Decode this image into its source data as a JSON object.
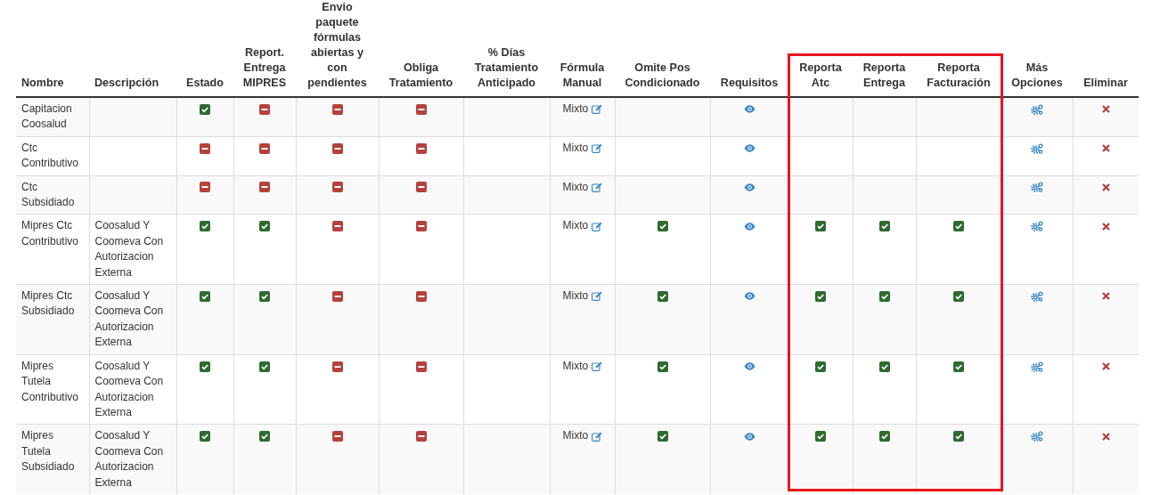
{
  "columns": [
    {
      "label": "Nombre",
      "kind": "label",
      "highlighted": false
    },
    {
      "label": "Descripción",
      "kind": "label",
      "highlighted": false
    },
    {
      "label": "Estado",
      "kind": "flag",
      "highlighted": false
    },
    {
      "label": "Report. Entrega MIPRES",
      "kind": "flag",
      "highlighted": false
    },
    {
      "label": "Envio paquete fórmulas abiertas y con pendientes",
      "kind": "flag",
      "highlighted": false
    },
    {
      "label": "Obliga Tratamiento",
      "kind": "flag",
      "highlighted": false
    },
    {
      "label": "% Días Tratamiento Anticipado",
      "kind": "text",
      "highlighted": false
    },
    {
      "label": "Fórmula Manual",
      "kind": "formula",
      "highlighted": false
    },
    {
      "label": "Omite Pos Condicionado",
      "kind": "flag",
      "highlighted": false
    },
    {
      "label": "Requisitos",
      "kind": "view",
      "highlighted": false
    },
    {
      "label": "Reporta Atc",
      "kind": "flag",
      "highlighted": true
    },
    {
      "label": "Reporta Entrega",
      "kind": "flag",
      "highlighted": true
    },
    {
      "label": "Reporta Facturación",
      "kind": "flag",
      "highlighted": true
    },
    {
      "label": "Más Opciones",
      "kind": "options",
      "highlighted": false
    },
    {
      "label": "Eliminar",
      "kind": "delete",
      "highlighted": false
    }
  ],
  "rows": [
    [
      {
        "text": "Capitacion Coosalud"
      },
      null,
      {
        "checked": true
      },
      {
        "checked": false
      },
      {
        "checked": false
      },
      {
        "checked": false
      },
      null,
      {
        "text": "Mixto"
      },
      null,
      null,
      null,
      null,
      null,
      null,
      null
    ],
    [
      {
        "text": "Ctc Contributivo"
      },
      null,
      {
        "checked": false
      },
      {
        "checked": false
      },
      {
        "checked": false
      },
      {
        "checked": false
      },
      null,
      {
        "text": "Mixto"
      },
      null,
      null,
      null,
      null,
      null,
      null,
      null
    ],
    [
      {
        "text": "Ctc Subsidiado"
      },
      null,
      {
        "checked": false
      },
      {
        "checked": false
      },
      {
        "checked": false
      },
      {
        "checked": false
      },
      null,
      {
        "text": "Mixto"
      },
      null,
      null,
      null,
      null,
      null,
      null,
      null
    ],
    [
      {
        "text": "Mipres Ctc Contributivo"
      },
      {
        "text": "Coosalud Y Coomeva Con Autorizacion Externa"
      },
      {
        "checked": true
      },
      {
        "checked": true
      },
      {
        "checked": false
      },
      {
        "checked": false
      },
      null,
      {
        "text": "Mixto"
      },
      {
        "checked": true
      },
      null,
      {
        "checked": true
      },
      {
        "checked": true
      },
      {
        "checked": true
      },
      null,
      null
    ],
    [
      {
        "text": "Mipres Ctc Subsidiado"
      },
      {
        "text": "Coosalud Y Coomeva Con Autorizacion Externa"
      },
      {
        "checked": true
      },
      {
        "checked": true
      },
      {
        "checked": false
      },
      {
        "checked": false
      },
      null,
      {
        "text": "Mixto"
      },
      {
        "checked": true
      },
      null,
      {
        "checked": true
      },
      {
        "checked": true
      },
      {
        "checked": true
      },
      null,
      null
    ],
    [
      {
        "text": "Mipres Tutela Contributivo"
      },
      {
        "text": "Coosalud Y Coomeva Con Autorizacion Externa"
      },
      {
        "checked": true
      },
      {
        "checked": true
      },
      {
        "checked": false
      },
      {
        "checked": false
      },
      null,
      {
        "text": "Mixto"
      },
      {
        "checked": true
      },
      null,
      {
        "checked": true
      },
      {
        "checked": true
      },
      {
        "checked": true
      },
      null,
      null
    ],
    [
      {
        "text": "Mipres Tutela Subsidiado"
      },
      {
        "text": "Coosalud Y Coomeva Con Autorizacion Externa"
      },
      {
        "checked": true
      },
      {
        "checked": true
      },
      {
        "checked": false
      },
      {
        "checked": false
      },
      null,
      {
        "text": "Mixto"
      },
      {
        "checked": true
      },
      null,
      {
        "checked": true
      },
      {
        "checked": true
      },
      {
        "checked": true
      },
      null,
      null
    ]
  ]
}
